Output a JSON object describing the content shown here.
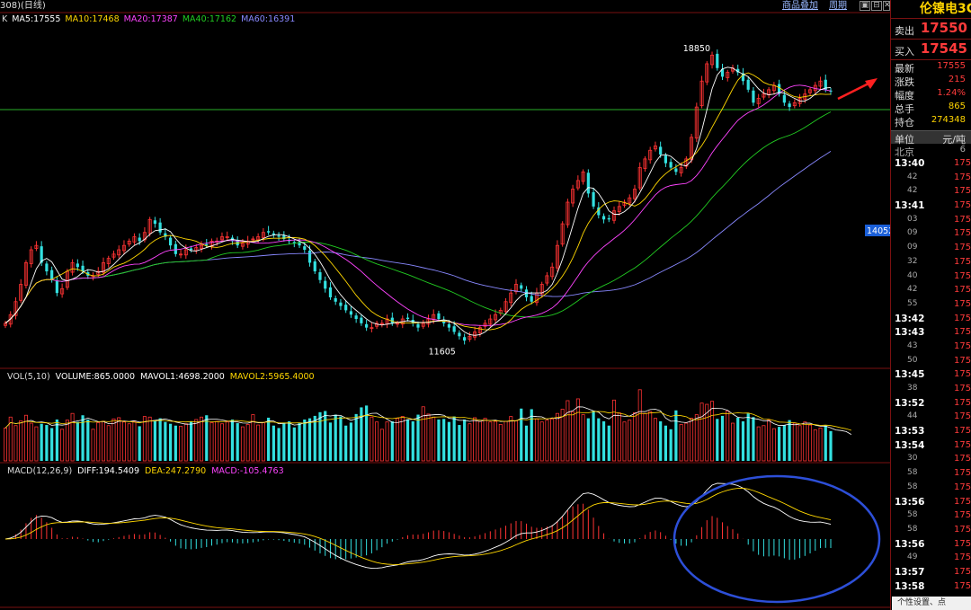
{
  "toolbar": {
    "title_prefix": "308)",
    "title": "(日线)",
    "btn_overlay": "商品叠加",
    "btn_period": "周期",
    "icon_buttons": [
      "▣",
      "⊟",
      "✕"
    ]
  },
  "panels": {
    "kline": {
      "label": "K",
      "ma": [
        {
          "name": "MA5",
          "value": "17555",
          "color": "#ffffff"
        },
        {
          "name": "MA10",
          "value": "17468",
          "color": "#ffd700"
        },
        {
          "name": "MA20",
          "value": "17387",
          "color": "#ff44ff"
        },
        {
          "name": "MA40",
          "value": "17162",
          "color": "#22cc22"
        },
        {
          "name": "MA60",
          "value": "16391",
          "color": "#8888ff"
        }
      ]
    },
    "volume": {
      "items": [
        {
          "text": "VOL(5,10)",
          "color": "#dddddd"
        },
        {
          "text": "VOLUME:865.0000",
          "color": "#ffffff"
        },
        {
          "text": "MAVOL1:4698.2000",
          "color": "#ffffff"
        },
        {
          "text": "MAVOL2:5965.4000",
          "color": "#ffd700"
        }
      ]
    },
    "macd": {
      "items": [
        {
          "text": "MACD(12,26,9)",
          "color": "#dddddd"
        },
        {
          "text": "DIFF:194.5409",
          "color": "#ffffff"
        },
        {
          "text": "DEA:247.2790",
          "color": "#ffd700"
        },
        {
          "text": "MACD:-105.4763",
          "color": "#ff44ff"
        }
      ]
    }
  },
  "chart_data": {
    "type": "candlestick",
    "price_range": [
      11200,
      19300
    ],
    "horizontal_level": 17100,
    "axis_price_label": "14052",
    "annotations": {
      "high": "18850",
      "low": "11605"
    },
    "close": [
      12200,
      12400,
      12700,
      13100,
      13600,
      13900,
      14000,
      13600,
      13400,
      13200,
      12900,
      13000,
      13400,
      13600,
      13500,
      13400,
      13300,
      13300,
      13400,
      13600,
      13700,
      13800,
      13900,
      14000,
      14100,
      14200,
      14100,
      14300,
      14600,
      14500,
      14300,
      14200,
      14000,
      13800,
      13800,
      13900,
      13900,
      13950,
      14000,
      14000,
      14100,
      14100,
      14200,
      14200,
      14100,
      14000,
      14050,
      14100,
      14150,
      14200,
      14300,
      14300,
      14250,
      14200,
      14150,
      14100,
      14050,
      14000,
      13900,
      13600,
      13400,
      13200,
      13000,
      12800,
      12700,
      12600,
      12500,
      12400,
      12300,
      12200,
      12100,
      12100,
      12200,
      12200,
      12300,
      12200,
      12200,
      12300,
      12300,
      12200,
      12100,
      12200,
      12300,
      12400,
      12300,
      12200,
      12100,
      12000,
      11900,
      11800,
      11900,
      12000,
      12100,
      12200,
      12300,
      12400,
      12500,
      12700,
      12900,
      13100,
      13000,
      12800,
      12700,
      12900,
      13100,
      13300,
      13500,
      14000,
      14500,
      15000,
      15300,
      15500,
      15700,
      15200,
      14900,
      14700,
      14600,
      14600,
      14800,
      14900,
      15000,
      15100,
      15300,
      15800,
      16000,
      16200,
      16300,
      16100,
      15900,
      15800,
      15700,
      15800,
      16000,
      16500,
      17200,
      17800,
      18200,
      18400,
      18100,
      17900,
      18000,
      18100,
      18000,
      17800,
      17600,
      17300,
      17400,
      17500,
      17600,
      17700,
      17500,
      17300,
      17200,
      17300,
      17400,
      17500,
      17600,
      17700,
      17800,
      17600,
      17555
    ],
    "vol_range": [
      0,
      13000
    ],
    "volume": [
      5400,
      7200,
      5800,
      6600,
      7500,
      6200,
      5600,
      6100,
      5900,
      5400,
      6800,
      5200,
      6700,
      7800,
      6400,
      7500,
      6800,
      5200,
      6300,
      6500,
      5800,
      6900,
      7100,
      6400,
      6100,
      6500,
      5700,
      7300,
      7200,
      6600,
      7000,
      6400,
      6100,
      5800,
      5700,
      6100,
      6500,
      6800,
      7200,
      7500,
      6300,
      6500,
      6100,
      6400,
      6800,
      6200,
      5600,
      6000,
      7600,
      5900,
      6300,
      7100,
      5800,
      5400,
      6300,
      6500,
      5500,
      6200,
      6800,
      7000,
      7400,
      8000,
      8200,
      6300,
      7600,
      7300,
      5800,
      6300,
      7700,
      8800,
      9100,
      7200,
      6400,
      5200,
      6400,
      6500,
      7000,
      7300,
      6800,
      6500,
      7600,
      8900,
      7700,
      7200,
      6800,
      6900,
      6400,
      7300,
      5900,
      6800,
      6100,
      7100,
      6500,
      7000,
      6400,
      6500,
      6000,
      6500,
      7300,
      6600,
      8600,
      5800,
      8500,
      6900,
      6400,
      6700,
      6900,
      7800,
      8500,
      9900,
      8100,
      10200,
      7600,
      7000,
      8200,
      7000,
      6500,
      5800,
      10000,
      7900,
      6400,
      6700,
      7900,
      11700,
      7800,
      8100,
      7000,
      6500,
      5800,
      5200,
      8300,
      6000,
      6200,
      7000,
      7600,
      9500,
      9300,
      9800,
      6900,
      7400,
      8200,
      6200,
      7100,
      6500,
      7800,
      7200,
      5600,
      5800,
      6700,
      5300,
      5600,
      5900,
      6700,
      6200,
      5800,
      6400,
      5900,
      5100,
      5400,
      5800,
      4900,
      4200,
      4700,
      4500,
      3400
    ]
  },
  "right_panel": {
    "title": "伦镍电3C",
    "sell_label": "卖出",
    "sell_value": "17550",
    "buy_label": "买入",
    "buy_value": "17545",
    "quote": [
      {
        "label": "最新",
        "value": "17555",
        "color": "#ff3b3b"
      },
      {
        "label": "涨跌",
        "value": "215",
        "color": "#ff3b3b"
      },
      {
        "label": "幅度",
        "value": "1.24%",
        "color": "#ff3b3b"
      },
      {
        "label": "总手",
        "value": "865",
        "color": "#ffd400"
      },
      {
        "label": "持仓",
        "value": "274348",
        "color": "#ffd400"
      }
    ],
    "unit_label": "单位",
    "unit_value": "元/吨",
    "beijing_label": "北京",
    "beijing_extra": "6",
    "ticks": [
      {
        "time": "13:40",
        "big": true
      },
      {
        "time": "42",
        "big": false
      },
      {
        "time": "42",
        "big": false
      },
      {
        "time": "13:41",
        "big": true
      },
      {
        "time": "03",
        "big": false
      },
      {
        "time": "09",
        "big": false
      },
      {
        "time": "09",
        "big": false
      },
      {
        "time": "32",
        "big": false
      },
      {
        "time": "40",
        "big": false
      },
      {
        "time": "42",
        "big": false
      },
      {
        "time": "55",
        "big": false
      },
      {
        "time": "13:42",
        "big": true
      },
      {
        "time": "13:43",
        "big": true
      },
      {
        "time": "43",
        "big": false
      },
      {
        "time": "50",
        "big": false
      },
      {
        "time": "13:45",
        "big": true
      },
      {
        "time": "38",
        "big": false
      },
      {
        "time": "13:52",
        "big": true
      },
      {
        "time": "44",
        "big": false
      },
      {
        "time": "13:53",
        "big": true
      },
      {
        "time": "13:54",
        "big": true
      },
      {
        "time": "30",
        "big": false
      },
      {
        "time": "58",
        "big": false
      },
      {
        "time": "58",
        "big": false
      },
      {
        "time": "13:56",
        "big": true
      },
      {
        "time": "58",
        "big": false
      },
      {
        "time": "58",
        "big": false
      },
      {
        "time": "13:56",
        "big": true
      },
      {
        "time": "49",
        "big": false
      },
      {
        "time": "13:57",
        "big": true
      },
      {
        "time": "13:58",
        "big": true
      }
    ],
    "tick_price": "175"
  },
  "tip": "个性设置、点"
}
